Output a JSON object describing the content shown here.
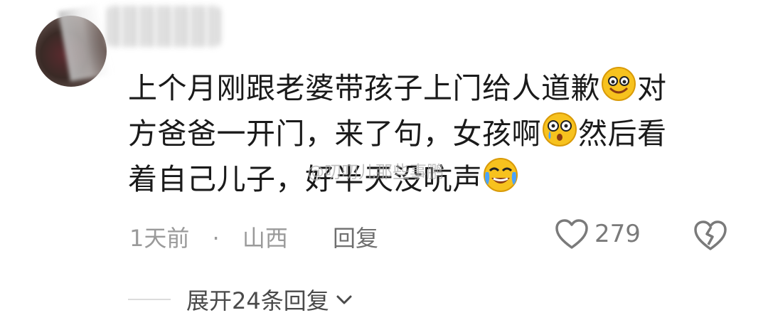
{
  "comment": {
    "line1": "上个月刚跟老婆带孩子上门给人道歉",
    "line1_tail": "对",
    "line2_head": "方爸爸一开门，来了句，女孩啊",
    "line2_tail": "然后看",
    "line3": "着自己儿子，好半天没吭声"
  },
  "watermark": "@叨叨儿那些事鹏",
  "meta": {
    "time": "1天前",
    "separator": "·",
    "location": "山西",
    "reply_label": "回复"
  },
  "actions": {
    "like_count": "279"
  },
  "expand": {
    "label": "展开24条回复"
  },
  "icons": {
    "emoji1": "smile-emoji-icon",
    "emoji2": "shocked-tear-emoji-icon",
    "emoji3": "crying-laugh-emoji-icon",
    "like": "heart-outline-icon",
    "dislike": "broken-heart-icon",
    "chevron": "chevron-down-icon"
  },
  "colors": {
    "text": "#1a1a1a",
    "meta": "#9a9a9a",
    "emoji": "#f7c21e"
  }
}
